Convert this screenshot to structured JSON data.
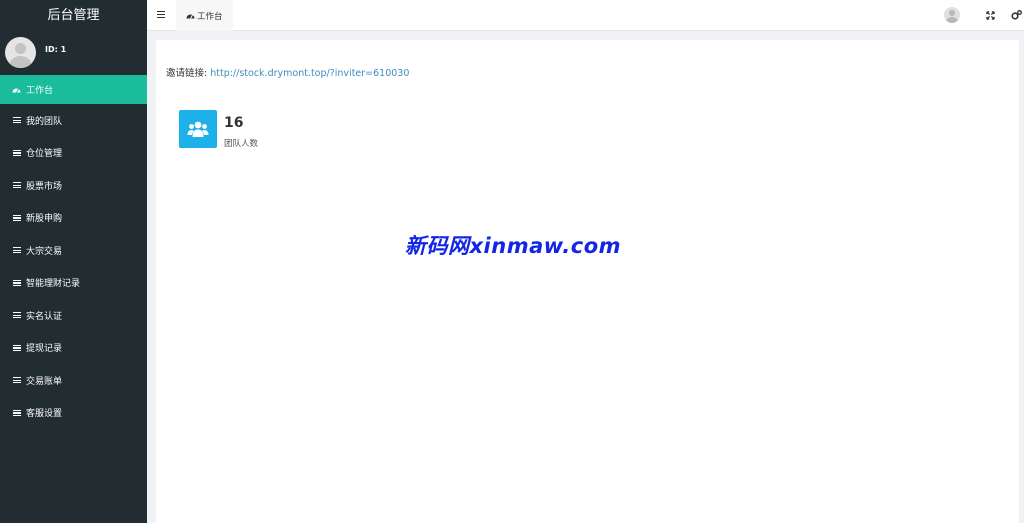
{
  "sidebar": {
    "title": "后台管理",
    "user_id": "ID: 1",
    "items": [
      {
        "label": "工作台",
        "icon": "dashboard-icon",
        "active": true
      },
      {
        "label": "我的团队",
        "icon": "list-icon"
      },
      {
        "label": "仓位管理",
        "icon": "list-icon"
      },
      {
        "label": "股票市场",
        "icon": "list-icon"
      },
      {
        "label": "新股申购",
        "icon": "list-icon"
      },
      {
        "label": "大宗交易",
        "icon": "list-icon"
      },
      {
        "label": "智能理财记录",
        "icon": "list-icon"
      },
      {
        "label": "实名认证",
        "icon": "list-icon"
      },
      {
        "label": "提现记录",
        "icon": "list-icon"
      },
      {
        "label": "交易账单",
        "icon": "list-icon"
      },
      {
        "label": "客服设置",
        "icon": "list-icon"
      }
    ]
  },
  "topbar": {
    "tab_label": "工作台",
    "icons": [
      "menu-toggle-icon",
      "user-avatar-icon",
      "fullscreen-icon",
      "settings-icon"
    ]
  },
  "main": {
    "invite_label": "邀请链接:",
    "invite_url": "http://stock.drymont.top/?inviter=610030",
    "stat": {
      "value": "16",
      "label": "团队人数",
      "icon": "users-icon"
    },
    "watermark": "新码网xinmaw.com"
  },
  "colors": {
    "sidebar_bg": "#222d32",
    "active_item": "#1abc9c",
    "stat_icon_bg": "#1eb0e8",
    "link": "#3c8dbc",
    "watermark": "#1326e5"
  }
}
